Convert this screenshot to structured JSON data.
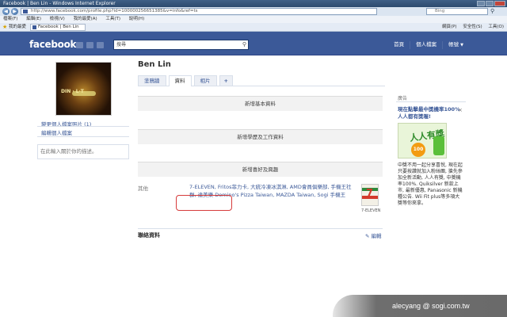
{
  "browser": {
    "window_title": "Facebook | Ben Lin - Windows Internet Explorer",
    "address": "http://www.facebook.com/profile.php?id=100000256651385&v=info&ref=ts",
    "search_placeholder": "Bing",
    "menu": [
      "檔案(F)",
      "編輯(E)",
      "檢視(V)",
      "我的最愛(A)",
      "工具(T)",
      "說明(H)"
    ],
    "favorites_label": "我的最愛",
    "tab_title": "Facebook | Ben Lin",
    "toolbar": [
      "網頁(P)",
      "安全性(S)",
      "工具(O)"
    ]
  },
  "fb_header": {
    "logo": "facebook",
    "search_placeholder": "搜尋",
    "nav": [
      "首頁",
      "個人檔案",
      "帳號"
    ]
  },
  "profile": {
    "name": "Ben Lin",
    "picture_caption": "DIN · L·T",
    "change_picture": "變更個人檔案照片 (1)",
    "edit_profile": "編輯個人檔案",
    "bio_placeholder": "在此輸入關於你的描述。",
    "tabs": [
      "塗鴉牆",
      "資料",
      "相片",
      "+"
    ]
  },
  "info": {
    "add_basic": "新增基本資料",
    "add_education": "新增學歷及工作資料",
    "add_interests": "新增喜好及興趣",
    "other_label": "其他",
    "other_text": "7-ELEVEN, Fritos菲力卡, 大統冷凍冰淇淋, AMD會員俱樂部, 手機王社群, 達美樂 Domino's Pizza Taiwan, MAZDA Taiwan, Sogi 手機王",
    "seven_label": "7-ELEVEN",
    "contact_title": "聯絡資料",
    "contact_edit": "編輯"
  },
  "ad": {
    "label": "廣告",
    "title": "現在點擊最中獎機率100%人人都有獎喔!",
    "image_text": "人人有獎",
    "badge": "100",
    "body": "中獎不用一起分享喜悅, 現在起只要按讚就加入粉絲團, 搶先參加全新活動, 人人有獎, 中獎機率100%. Quiksilver 新款上市, 最新優惠, Panasonic 新機種公告. Wii Fit plus等多項大獎等你來拿。"
  },
  "watermark": "alecyang  @ sogi.com.tw"
}
